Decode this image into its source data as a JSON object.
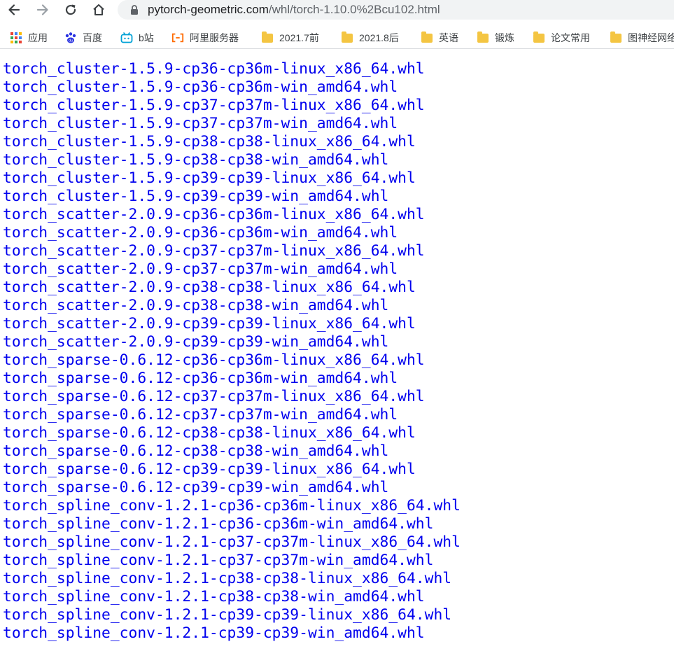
{
  "browser": {
    "url_host": "pytorch-geometric.com",
    "url_path": "/whl/torch-1.10.0%2Bcu102.html"
  },
  "bookmarks": [
    {
      "label": "应用",
      "icon": "apps-grid-icon"
    },
    {
      "label": "百度",
      "icon": "baidu-paw-icon"
    },
    {
      "label": "b站",
      "icon": "bilibili-tv-icon"
    },
    {
      "label": "阿里服务器",
      "icon": "aliyun-icon"
    },
    {
      "label": "2021.7前",
      "icon": "folder-icon"
    },
    {
      "label": "2021.8后",
      "icon": "folder-icon"
    },
    {
      "label": "英语",
      "icon": "folder-icon"
    },
    {
      "label": "锻炼",
      "icon": "folder-icon"
    },
    {
      "label": "论文常用",
      "icon": "folder-icon"
    },
    {
      "label": "图神经网络",
      "icon": "folder-icon"
    }
  ],
  "links": [
    "torch_cluster-1.5.9-cp36-cp36m-linux_x86_64.whl",
    "torch_cluster-1.5.9-cp36-cp36m-win_amd64.whl",
    "torch_cluster-1.5.9-cp37-cp37m-linux_x86_64.whl",
    "torch_cluster-1.5.9-cp37-cp37m-win_amd64.whl",
    "torch_cluster-1.5.9-cp38-cp38-linux_x86_64.whl",
    "torch_cluster-1.5.9-cp38-cp38-win_amd64.whl",
    "torch_cluster-1.5.9-cp39-cp39-linux_x86_64.whl",
    "torch_cluster-1.5.9-cp39-cp39-win_amd64.whl",
    "torch_scatter-2.0.9-cp36-cp36m-linux_x86_64.whl",
    "torch_scatter-2.0.9-cp36-cp36m-win_amd64.whl",
    "torch_scatter-2.0.9-cp37-cp37m-linux_x86_64.whl",
    "torch_scatter-2.0.9-cp37-cp37m-win_amd64.whl",
    "torch_scatter-2.0.9-cp38-cp38-linux_x86_64.whl",
    "torch_scatter-2.0.9-cp38-cp38-win_amd64.whl",
    "torch_scatter-2.0.9-cp39-cp39-linux_x86_64.whl",
    "torch_scatter-2.0.9-cp39-cp39-win_amd64.whl",
    "torch_sparse-0.6.12-cp36-cp36m-linux_x86_64.whl",
    "torch_sparse-0.6.12-cp36-cp36m-win_amd64.whl",
    "torch_sparse-0.6.12-cp37-cp37m-linux_x86_64.whl",
    "torch_sparse-0.6.12-cp37-cp37m-win_amd64.whl",
    "torch_sparse-0.6.12-cp38-cp38-linux_x86_64.whl",
    "torch_sparse-0.6.12-cp38-cp38-win_amd64.whl",
    "torch_sparse-0.6.12-cp39-cp39-linux_x86_64.whl",
    "torch_sparse-0.6.12-cp39-cp39-win_amd64.whl",
    "torch_spline_conv-1.2.1-cp36-cp36m-linux_x86_64.whl",
    "torch_spline_conv-1.2.1-cp36-cp36m-win_amd64.whl",
    "torch_spline_conv-1.2.1-cp37-cp37m-linux_x86_64.whl",
    "torch_spline_conv-1.2.1-cp37-cp37m-win_amd64.whl",
    "torch_spline_conv-1.2.1-cp38-cp38-linux_x86_64.whl",
    "torch_spline_conv-1.2.1-cp38-cp38-win_amd64.whl",
    "torch_spline_conv-1.2.1-cp39-cp39-linux_x86_64.whl",
    "torch_spline_conv-1.2.1-cp39-cp39-win_amd64.whl"
  ],
  "colors": {
    "link": "#0000ee",
    "folder": "#f4c542",
    "omnibox_bg": "#f1f3f4"
  }
}
